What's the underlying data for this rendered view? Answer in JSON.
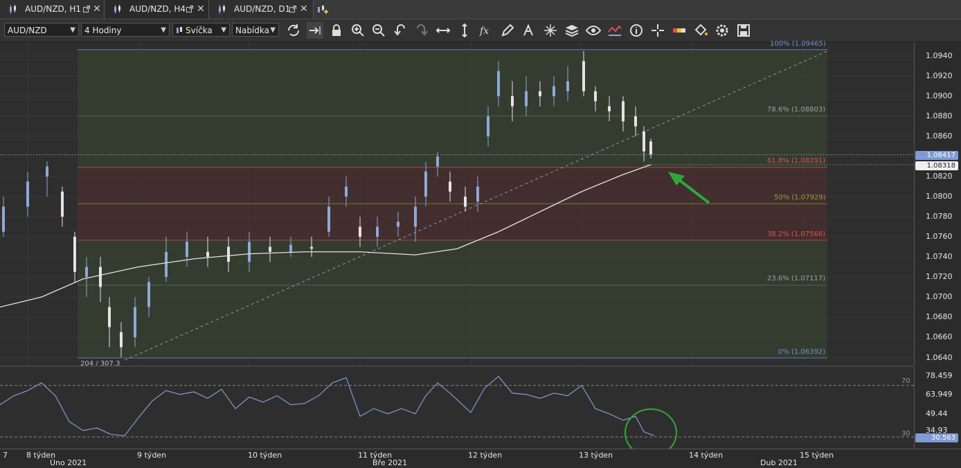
{
  "tabs": [
    {
      "label": "AUD/NZD, H1"
    },
    {
      "label": "AUD/NZD, H4"
    },
    {
      "label": "AUD/NZD, D1"
    }
  ],
  "toolbar": {
    "symbol": "AUD/NZD",
    "timeframe": "4 Hodiny",
    "chart_type": "Svíčka",
    "price_side": "Nabídka"
  },
  "price_axis": [
    "1.0940",
    "1.0920",
    "1.0900",
    "1.0880",
    "1.0860",
    "1.0820",
    "1.0800",
    "1.0780",
    "1.0760",
    "1.0740",
    "1.0720",
    "1.0700",
    "1.0680",
    "1.0660",
    "1.0640"
  ],
  "current_price": "1.08417",
  "ma_price": "1.08318",
  "fib_levels": [
    {
      "label": "100% (1.09465)",
      "color": "#6d8fd6"
    },
    {
      "label": "78.6% (1.08803)",
      "color": "#9aa39a"
    },
    {
      "label": "61.8% (1.08291)",
      "color": "#e05050"
    },
    {
      "label": "50% (1.07929)",
      "color": "#8aa03a"
    },
    {
      "label": "38.2% (1.07566)",
      "color": "#e05050"
    },
    {
      "label": "23.6% (1.07117)",
      "color": "#9aa39a"
    },
    {
      "label": "0% (1.06392)",
      "color": "#6d8fd6"
    }
  ],
  "trend_label": "204 / 307.3",
  "rsi": {
    "axis": [
      "78.459",
      "63.949",
      "49.44",
      "34.93"
    ],
    "current": "30.563",
    "level_high": "70",
    "level_low": "30"
  },
  "time_axis": {
    "weeks": [
      "7",
      "8 týden",
      "9 týden",
      "10 týden",
      "11 týden",
      "12 týden",
      "13 týden",
      "14 týden",
      "15 týden"
    ],
    "months": [
      "Úno 2021",
      "Bře 2021",
      "Dub 2021"
    ]
  },
  "colors": {
    "bull": "#8fa8d8",
    "bear": "#e8e0e6",
    "ma": "#e8e4e0",
    "rsi": "#7f9bd4",
    "annotation": "#2fa83a"
  },
  "icons": [
    "refresh-icon",
    "auto-scroll-icon",
    "lock-icon",
    "zoom-in-icon",
    "zoom-out-icon",
    "undo-icon",
    "redo-icon",
    "horizontal-line-icon",
    "vertical-line-icon",
    "function-icon",
    "pencil-icon",
    "text-icon",
    "crosshair-icon",
    "layers-icon",
    "eye-icon",
    "indicator-icon",
    "info-icon",
    "cursor-icon",
    "color-icon",
    "fill-icon",
    "settings-icon",
    "save-icon"
  ]
}
